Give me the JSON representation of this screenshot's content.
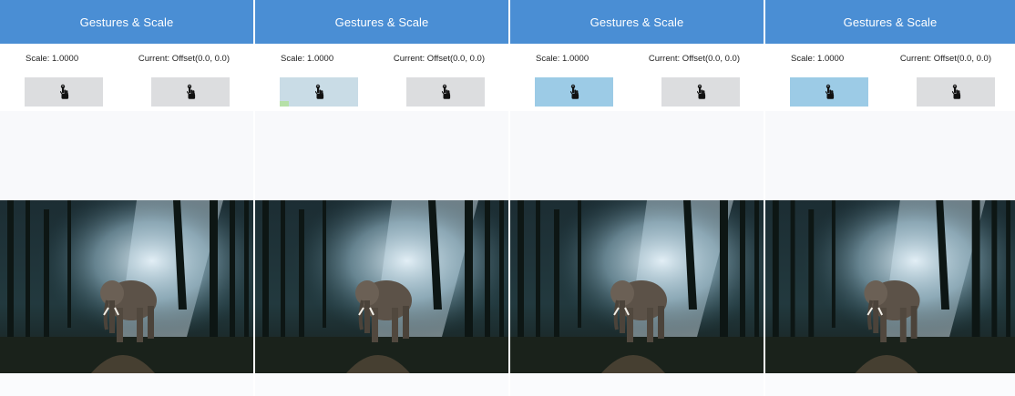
{
  "panels": [
    {
      "title": "Gestures & Scale",
      "scale_text": "Scale: 1.0000",
      "offset_text": "Current: Offset(0.0, 0.0)",
      "left_button_state": "idle",
      "right_button_state": "idle"
    },
    {
      "title": "Gestures & Scale",
      "scale_text": "Scale: 1.0000",
      "offset_text": "Current: Offset(0.0, 0.0)",
      "left_button_state": "pressed-light",
      "right_button_state": "idle"
    },
    {
      "title": "Gestures & Scale",
      "scale_text": "Scale: 1.0000",
      "offset_text": "Current: Offset(0.0, 0.0)",
      "left_button_state": "active",
      "right_button_state": "idle"
    },
    {
      "title": "Gestures & Scale",
      "scale_text": "Scale: 1.0000",
      "offset_text": "Current: Offset(0.0, 0.0)",
      "left_button_state": "active",
      "right_button_state": "idle"
    }
  ],
  "icons": {
    "button_icon": "touch-hand-icon"
  },
  "image": {
    "subject": "elephant-in-misty-forest"
  },
  "colors": {
    "appbar": "#4a8ed4",
    "button_idle": "#dcdddf",
    "button_active": "#9ccbe6",
    "button_pressed_light": "#c9dce6",
    "background": "#fafbfd"
  }
}
